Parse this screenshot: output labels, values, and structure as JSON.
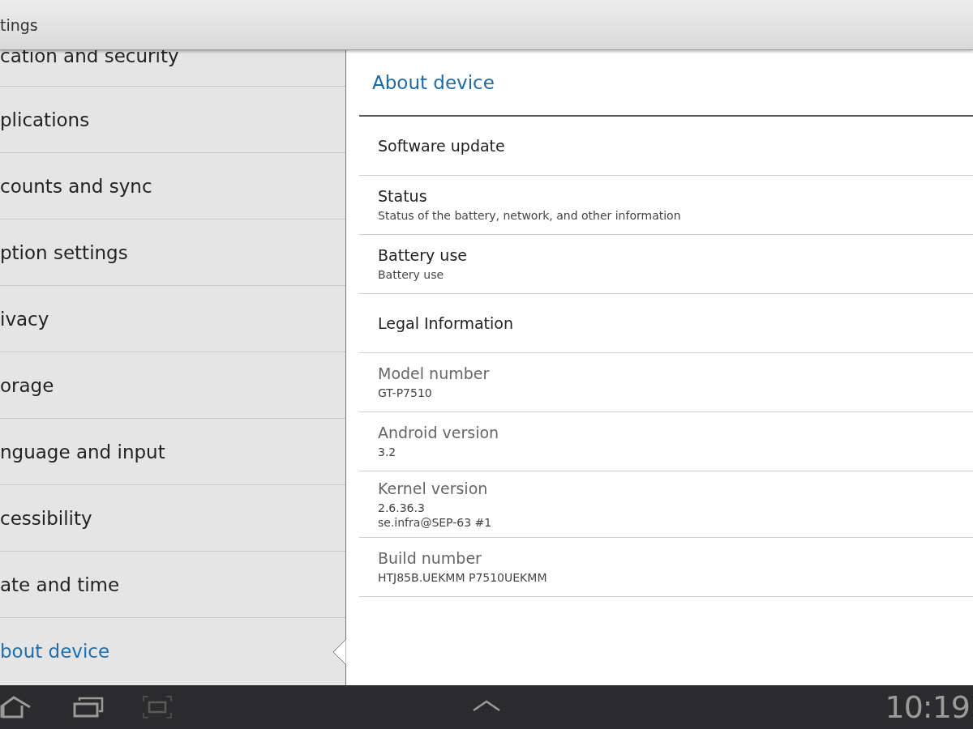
{
  "action_bar": {
    "title": "tings"
  },
  "sidebar": {
    "items": [
      {
        "label": "cation and security",
        "selected": false
      },
      {
        "label": "plications",
        "selected": false
      },
      {
        "label": "counts and sync",
        "selected": false
      },
      {
        "label": "ption settings",
        "selected": false
      },
      {
        "label": "ivacy",
        "selected": false
      },
      {
        "label": "orage",
        "selected": false
      },
      {
        "label": "nguage and input",
        "selected": false
      },
      {
        "label": "cessibility",
        "selected": false
      },
      {
        "label": "ate and time",
        "selected": false
      },
      {
        "label": "bout device",
        "selected": true
      }
    ]
  },
  "detail": {
    "title": "About device",
    "items": [
      {
        "title": "Software update",
        "disabled": false
      },
      {
        "title": "Status",
        "summary": "Status of the battery, network, and other information",
        "disabled": false
      },
      {
        "title": "Battery use",
        "summary": "Battery use",
        "disabled": false
      },
      {
        "title": "Legal Information",
        "disabled": false
      },
      {
        "title": "Model number",
        "summary": "GT-P7510",
        "disabled": true
      },
      {
        "title": "Android version",
        "summary": "3.2",
        "disabled": true
      },
      {
        "title": "Kernel version",
        "summary": "2.6.36.3\nse.infra@SEP-63 #1",
        "disabled": true
      },
      {
        "title": "Build number",
        "summary": "HTJ85B.UEKMM P7510UEKMM",
        "disabled": true
      }
    ]
  },
  "system_bar": {
    "clock": "10:19"
  }
}
